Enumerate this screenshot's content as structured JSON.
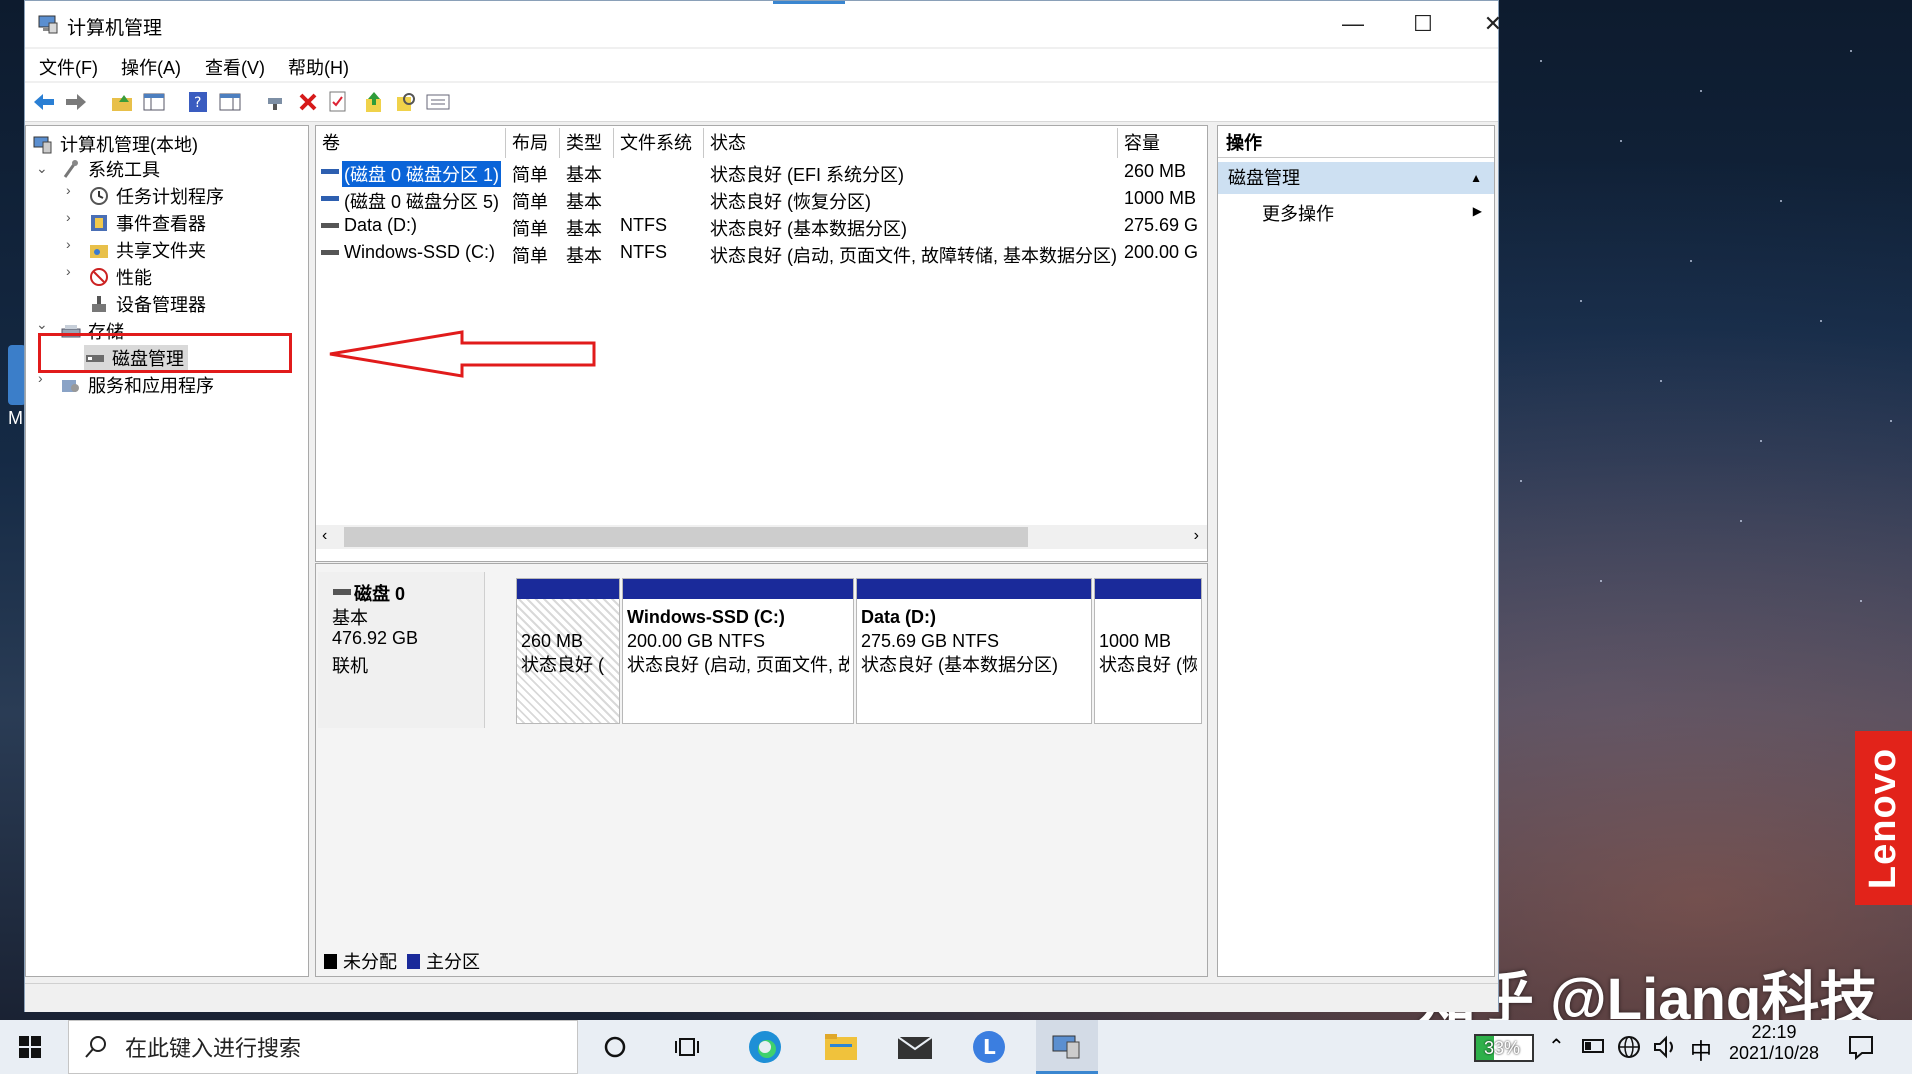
{
  "window": {
    "title": "计算机管理",
    "controls": {
      "minimize": "—",
      "maximize": "☐",
      "close": "✕"
    }
  },
  "menu": [
    "文件(F)",
    "操作(A)",
    "查看(V)",
    "帮助(H)"
  ],
  "tree": {
    "root": "计算机管理(本地)",
    "system_tools": "系统工具",
    "task_scheduler": "任务计划程序",
    "event_viewer": "事件查看器",
    "shared_folders": "共享文件夹",
    "performance": "性能",
    "device_manager": "设备管理器",
    "storage": "存储",
    "disk_management": "磁盘管理",
    "services_apps": "服务和应用程序"
  },
  "volume_table": {
    "columns": [
      "卷",
      "布局",
      "类型",
      "文件系统",
      "状态",
      "容量"
    ],
    "rows": [
      {
        "volume": "(磁盘 0 磁盘分区 1)",
        "layout": "简单",
        "type": "基本",
        "fs": "",
        "status": "状态良好 (EFI 系统分区)",
        "capacity": "260 MB"
      },
      {
        "volume": "(磁盘 0 磁盘分区 5)",
        "layout": "简单",
        "type": "基本",
        "fs": "",
        "status": "状态良好 (恢复分区)",
        "capacity": "1000 MB"
      },
      {
        "volume": "Data (D:)",
        "layout": "简单",
        "type": "基本",
        "fs": "NTFS",
        "status": "状态良好 (基本数据分区)",
        "capacity": "275.69 G"
      },
      {
        "volume": "Windows-SSD (C:)",
        "layout": "简单",
        "type": "基本",
        "fs": "NTFS",
        "status": "状态良好 (启动, 页面文件, 故障转储, 基本数据分区)",
        "capacity": "200.00 G"
      }
    ]
  },
  "disk": {
    "name": "磁盘 0",
    "kind": "基本",
    "size": "476.92 GB",
    "state": "联机",
    "partitions": [
      {
        "title": "",
        "size": "260 MB",
        "status": "状态良好 ("
      },
      {
        "title": "Windows-SSD  (C:)",
        "size": "200.00 GB NTFS",
        "status": "状态良好 (启动, 页面文件, 故"
      },
      {
        "title": "Data  (D:)",
        "size": "275.69 GB NTFS",
        "status": "状态良好 (基本数据分区)"
      },
      {
        "title": "",
        "size": "1000 MB",
        "status": "状态良好 (恢复"
      }
    ]
  },
  "legend": {
    "unallocated": "未分配",
    "primary": "主分区"
  },
  "actions": {
    "header": "操作",
    "section": "磁盘管理",
    "more": "更多操作"
  },
  "taskbar": {
    "search_placeholder": "在此键入进行搜索",
    "battery": "33%",
    "ime": "中",
    "time": "22:19",
    "date": "2021/10/28"
  },
  "overlay": {
    "watermark": "知乎 @Liang科技",
    "brand": "Lenovo",
    "left_letter": "M"
  },
  "colors": {
    "primary_partition": "#1a2a9a",
    "annotation": "#e11b1b",
    "selection": "#0a64d8"
  }
}
